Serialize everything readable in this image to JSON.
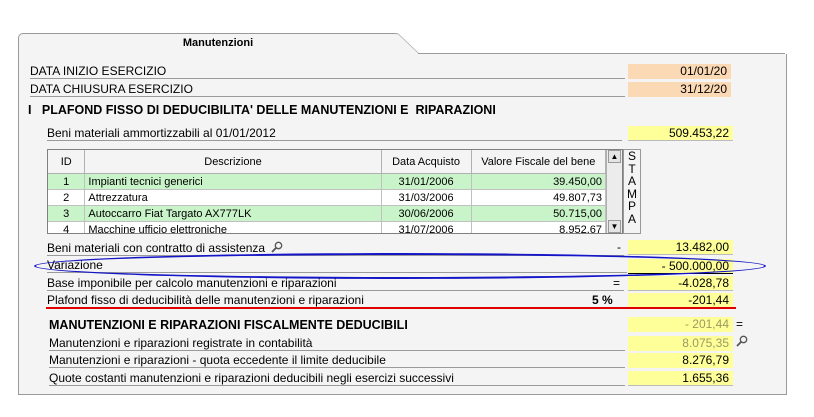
{
  "tab": {
    "label": "Manutenzioni"
  },
  "header": {
    "start_label": "DATA INIZIO ESERCIZIO",
    "start_value": "01/01/20",
    "end_label": "DATA CHIUSURA ESERCIZIO",
    "end_value": "31/12/20"
  },
  "section1": {
    "title": "I   PLAFOND FISSO DI DEDUCIBILITA' DELLE MANUTENZIONI E  RIPARAZIONI",
    "beni_label": "Beni materiali ammortizzabili al 01/01/2012",
    "beni_value": "509.453,22"
  },
  "grid": {
    "columns": [
      "ID",
      "Descrizione",
      "Data Acquisto",
      "Valore Fiscale del bene"
    ],
    "rows": [
      {
        "id": "1",
        "desc": "Impianti tecnici generici",
        "date": "31/01/2006",
        "value": "39.450,00"
      },
      {
        "id": "2",
        "desc": "Attrezzatura",
        "date": "31/03/2006",
        "value": "49.807,73"
      },
      {
        "id": "3",
        "desc": "Autoccarro Fiat Targato AX777LK",
        "date": "30/06/2006",
        "value": "50.715,00"
      },
      {
        "id": "4",
        "desc": "Macchine ufficio elettroniche",
        "date": "31/07/2006",
        "value": "8.952,67"
      }
    ],
    "stampa": [
      "S",
      "T",
      "A",
      "M",
      "P",
      "A"
    ]
  },
  "lines": {
    "assist_label": "Beni materiali con contratto di assistenza",
    "assist_sign": "-",
    "assist_value": "13.482,00",
    "var_label": "Variazione",
    "var_value": "-  500.000,00",
    "base_label": "Base imponibile per calcolo manutenzioni e riparazioni",
    "base_sign": "=",
    "base_value": "-4.028,78",
    "plafond_label": "Plafond fisso di deducibilità delle manutenzioni e riparazioni",
    "plafond_pct": "5 %",
    "plafond_value": "-201,44"
  },
  "section2": {
    "title": "MANUTENZIONI E RIPARAZIONI FISCALMENTE DEDUCIBILI",
    "title_value": "- 201,44",
    "title_sign": "=",
    "reg_label": "Manutenzioni e riparazioni registrate in contabilità",
    "reg_value": "8.075,35",
    "ecc_label": "Manutenzioni e riparazioni - quota eccedente il limite deducibile",
    "ecc_value": "8.276,79",
    "quote_label": "Quote costanti manutenzioni e riparazioni deducibili negli esercizi successivi",
    "quote_value": "1.655,36"
  },
  "colors": {
    "panel": "#f4f4f4",
    "peach": "#fbd9b5",
    "yellow": "#ffff99",
    "green_row": "#c9f4c9",
    "ellipse": "#1414c8",
    "red_line": "#e00000"
  }
}
